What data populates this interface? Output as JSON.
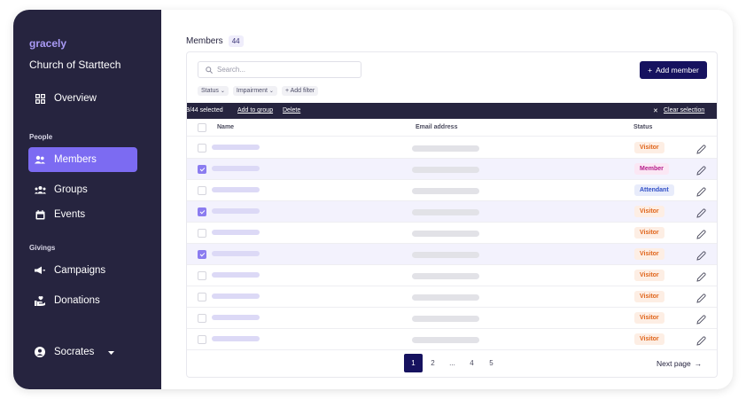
{
  "sidebar": {
    "brand": "gracely",
    "org": "Church of Starttech",
    "overview": "Overview",
    "section_people": "People",
    "members": "Members",
    "groups": "Groups",
    "events": "Events",
    "section_givings": "Givings",
    "campaigns": "Campaigns",
    "donations": "Donations",
    "user": "Socrates"
  },
  "main": {
    "title": "Members",
    "count": "44",
    "search_placeholder": "Search...",
    "add_member": "Add member",
    "filters": [
      "Status",
      "Impairment",
      "+ Add filter"
    ],
    "selection": {
      "text": "3/44 selected",
      "add_to_group": "Add to group",
      "delete": "Delete",
      "clear": "Clear selection"
    },
    "columns": {
      "name": "Name",
      "email": "Email address",
      "status": "Status"
    },
    "rows": [
      {
        "selected": false,
        "status": "Visitor",
        "kind": "visitor"
      },
      {
        "selected": true,
        "status": "Member",
        "kind": "member"
      },
      {
        "selected": false,
        "status": "Attendant",
        "kind": "attendant"
      },
      {
        "selected": true,
        "status": "Visitor",
        "kind": "visitor"
      },
      {
        "selected": false,
        "status": "Visitor",
        "kind": "visitor"
      },
      {
        "selected": true,
        "status": "Visitor",
        "kind": "visitor"
      },
      {
        "selected": false,
        "status": "Visitor",
        "kind": "visitor"
      },
      {
        "selected": false,
        "status": "Visitor",
        "kind": "visitor"
      },
      {
        "selected": false,
        "status": "Visitor",
        "kind": "visitor"
      },
      {
        "selected": false,
        "status": "Visitor",
        "kind": "visitor"
      }
    ],
    "pagination": {
      "pages": [
        "1",
        "2",
        "...",
        "4",
        "5"
      ],
      "current": "1",
      "next": "Next page"
    }
  },
  "colors": {
    "sidebar": "#26243f",
    "accent": "#7c6bf2",
    "primary_button": "#16125f"
  }
}
